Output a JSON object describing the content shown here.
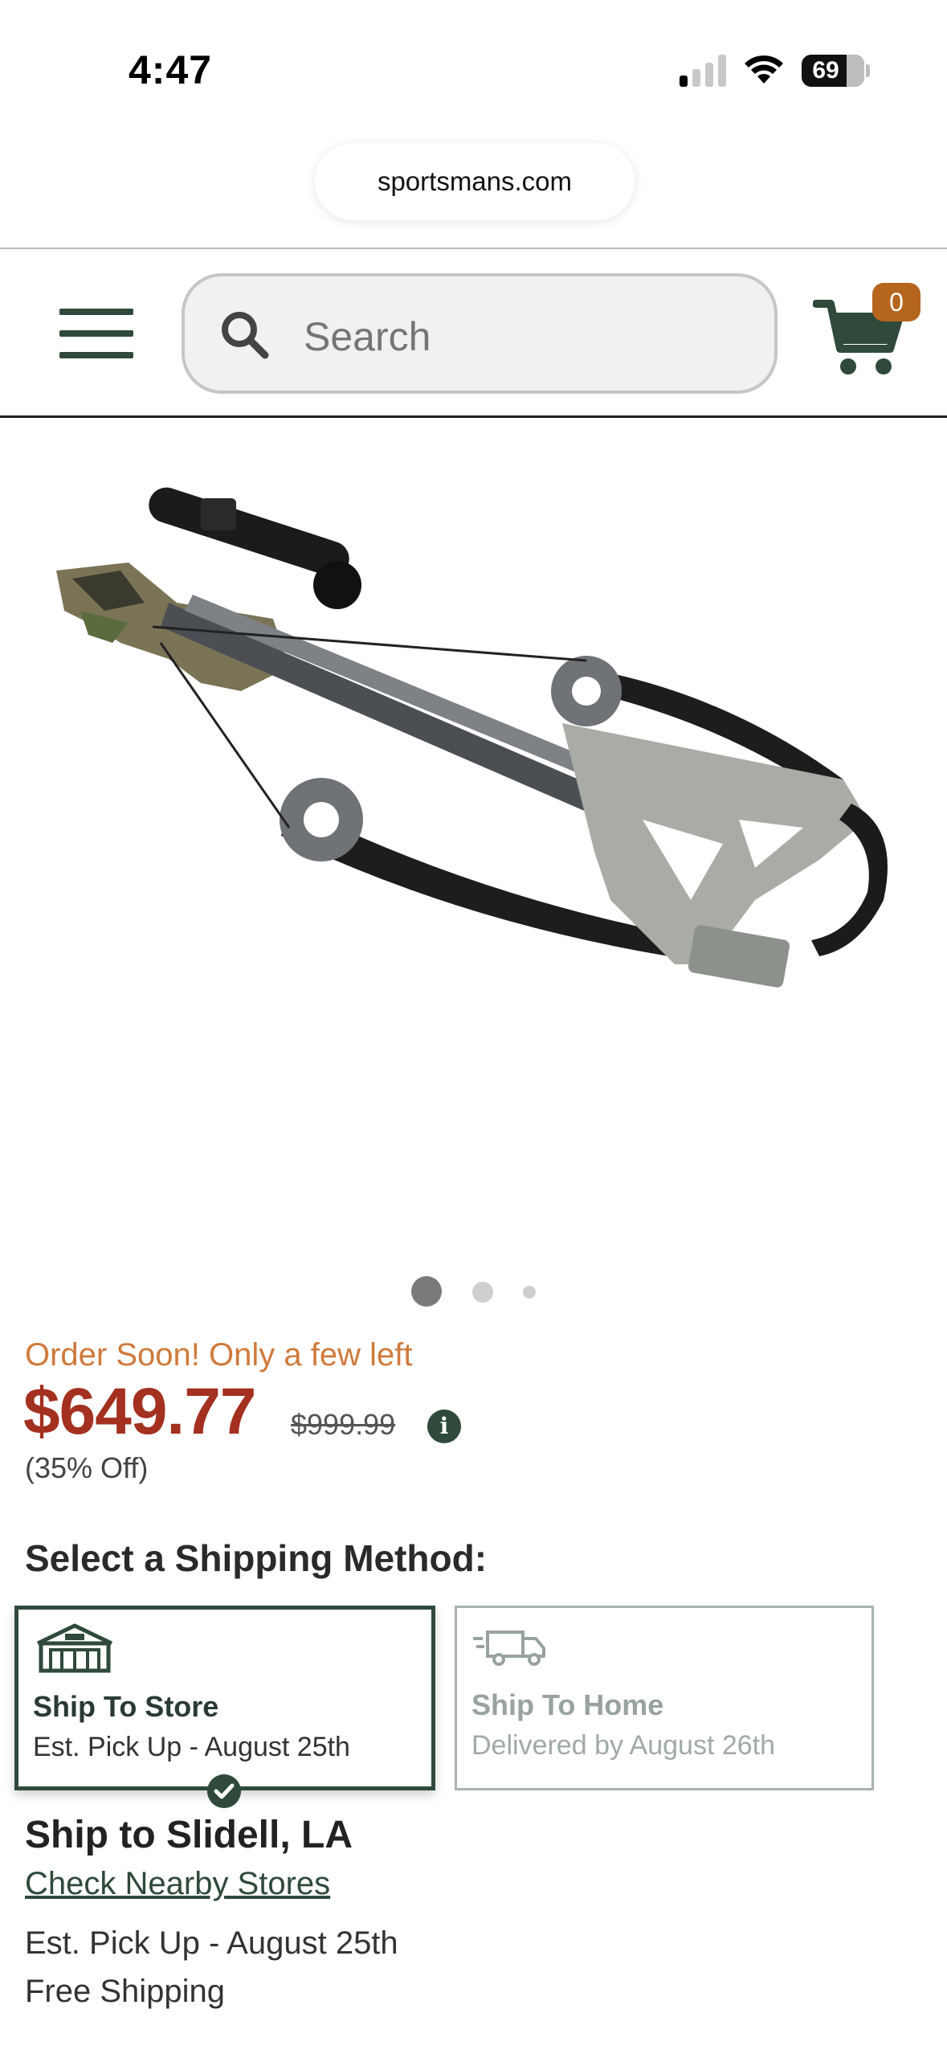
{
  "status_bar": {
    "time": "4:47",
    "battery_percent": "69"
  },
  "browser": {
    "url": "sportsmans.com"
  },
  "header": {
    "search_placeholder": "Search",
    "cart_count": "0"
  },
  "product": {
    "image_alt": "crossbow-product-image",
    "carousel_active_index": 1,
    "carousel_count": 3,
    "stock_message": "Order Soon! Only a few left",
    "price": "$649.77",
    "original_price": "$999.99",
    "discount": "(35% Off)"
  },
  "shipping": {
    "heading": "Select a Shipping Method:",
    "options": [
      {
        "title": "Ship To Store",
        "subtitle": "Est. Pick Up - August 25th",
        "selected": true,
        "icon": "store-icon"
      },
      {
        "title": "Ship To Home",
        "subtitle": "Delivered by August 26th",
        "selected": false,
        "icon": "truck-icon"
      }
    ],
    "ship_to": "Ship to Slidell, LA",
    "nearby_link": "Check Nearby Stores",
    "pickup_estimate": "Est. Pick Up - August 25th",
    "shipping_cost": "Free Shipping"
  },
  "colors": {
    "brand_green": "#2f4a3a",
    "price_red": "#a4301f",
    "stock_orange": "#cf7a3b",
    "cart_badge": "#b5651d"
  }
}
